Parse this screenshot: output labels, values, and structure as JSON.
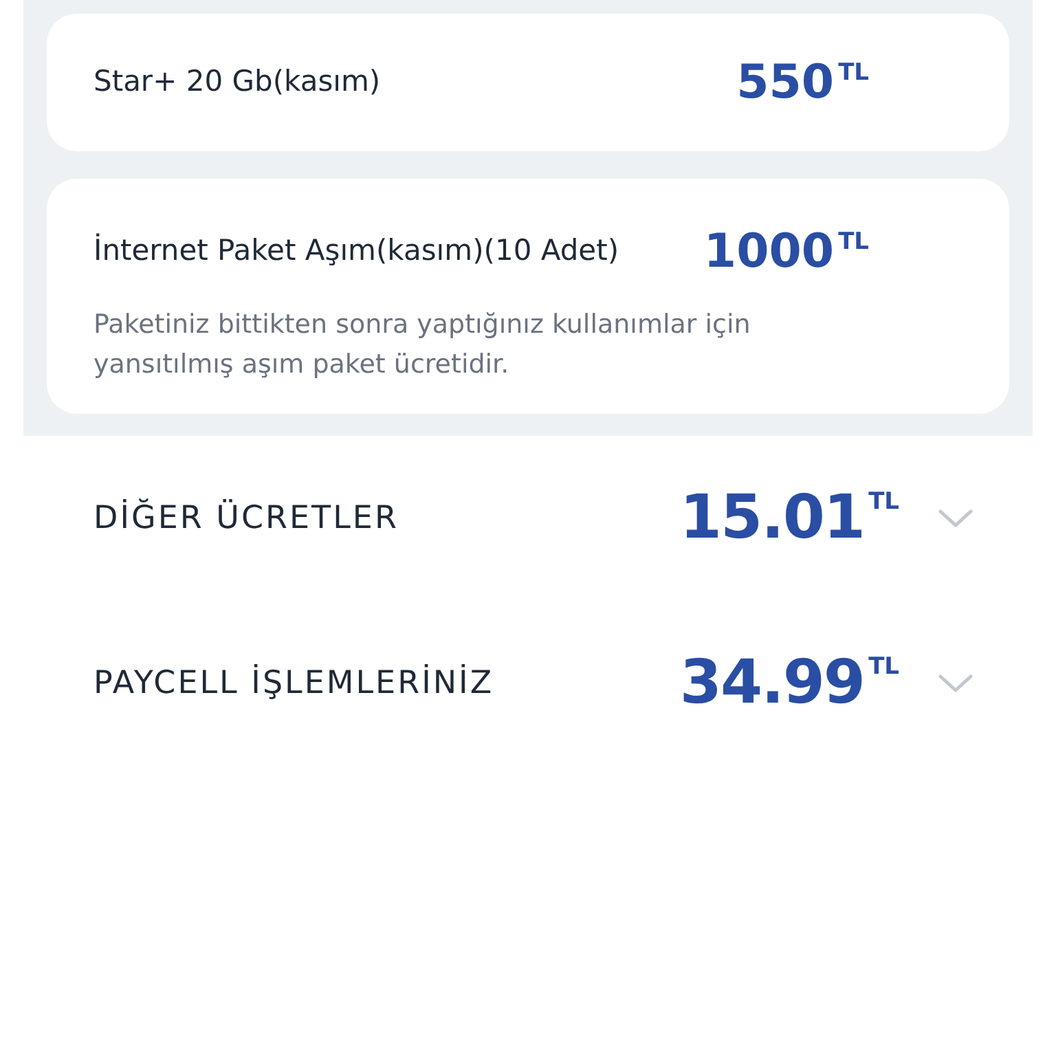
{
  "packages": [
    {
      "name": "Star+ 20 Gb(kasım)",
      "amount": "550",
      "currency": "TL"
    },
    {
      "name": "İnternet Paket Aşım(kasım)(10 Adet)",
      "amount": "1000",
      "currency": "TL",
      "description": "Paketiniz bittikten sonra yaptığınız kullanımlar için yansıtılmış aşım paket ücretidir."
    }
  ],
  "sections": [
    {
      "title": "DİĞER ÜCRETLER",
      "amount": "15.01",
      "currency": "TL",
      "expanded": false
    },
    {
      "title": "PAYCELL İŞLEMLERİNİZ",
      "amount": "34.99",
      "currency": "TL",
      "expanded": false
    }
  ]
}
